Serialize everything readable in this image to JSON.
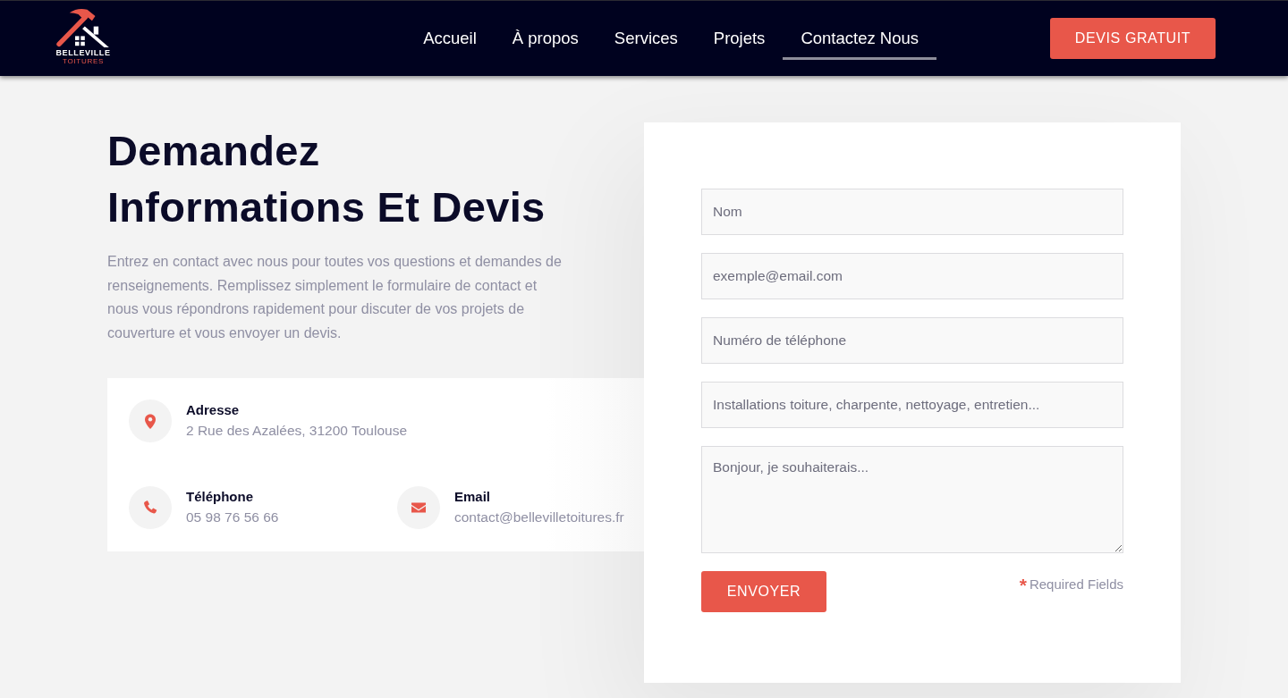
{
  "header": {
    "logo": {
      "name": "BELLEVILLE",
      "tagline": "TOITURES"
    },
    "nav": [
      {
        "label": "Accueil",
        "selected": false
      },
      {
        "label": "À propos",
        "selected": false
      },
      {
        "label": "Services",
        "selected": false
      },
      {
        "label": "Projets",
        "selected": false
      },
      {
        "label": "Contactez Nous",
        "selected": true
      }
    ],
    "cta": "DEVIS GRATUIT"
  },
  "intro": {
    "heading": "Demandez Informations Et Devis",
    "text": "Entrez en contact avec nous pour toutes vos questions et demandes de renseignements. Remplissez simplement le formulaire de contact et nous vous répondrons rapidement pour discuter de vos projets de couverture et vous envoyer un devis."
  },
  "contact_info": {
    "rows": [
      [
        {
          "kind": "address",
          "label": "Adresse",
          "value": "2 Rue des Azalées, 31200 Toulouse"
        }
      ],
      [
        {
          "kind": "phone",
          "label": "Téléphone",
          "value": "05 98 76 56 66"
        },
        {
          "kind": "email",
          "label": "Email",
          "value": "contact@bellevilletoitures.fr"
        }
      ]
    ]
  },
  "form": {
    "fields": [
      {
        "kind": "input",
        "placeholder": "Nom"
      },
      {
        "kind": "input",
        "placeholder": "exemple@email.com"
      },
      {
        "kind": "input",
        "placeholder": "Numéro de téléphone"
      },
      {
        "kind": "input",
        "placeholder": "Installations toiture, charpente, nettoyage, entretien..."
      },
      {
        "kind": "textarea",
        "placeholder": "Bonjour, je souhaiterais..."
      }
    ],
    "submit": "ENVOYER",
    "required_note": {
      "mark": "*",
      "text": "Required Fields"
    }
  }
}
